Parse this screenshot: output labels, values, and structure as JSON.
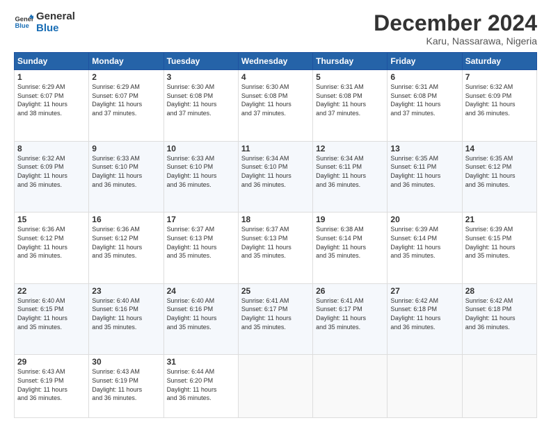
{
  "header": {
    "logo_line1": "General",
    "logo_line2": "Blue",
    "month": "December 2024",
    "location": "Karu, Nassarawa, Nigeria"
  },
  "days_of_week": [
    "Sunday",
    "Monday",
    "Tuesday",
    "Wednesday",
    "Thursday",
    "Friday",
    "Saturday"
  ],
  "weeks": [
    [
      {
        "day": "1",
        "info": "Sunrise: 6:29 AM\nSunset: 6:07 PM\nDaylight: 11 hours\nand 38 minutes."
      },
      {
        "day": "2",
        "info": "Sunrise: 6:29 AM\nSunset: 6:07 PM\nDaylight: 11 hours\nand 37 minutes."
      },
      {
        "day": "3",
        "info": "Sunrise: 6:30 AM\nSunset: 6:08 PM\nDaylight: 11 hours\nand 37 minutes."
      },
      {
        "day": "4",
        "info": "Sunrise: 6:30 AM\nSunset: 6:08 PM\nDaylight: 11 hours\nand 37 minutes."
      },
      {
        "day": "5",
        "info": "Sunrise: 6:31 AM\nSunset: 6:08 PM\nDaylight: 11 hours\nand 37 minutes."
      },
      {
        "day": "6",
        "info": "Sunrise: 6:31 AM\nSunset: 6:08 PM\nDaylight: 11 hours\nand 37 minutes."
      },
      {
        "day": "7",
        "info": "Sunrise: 6:32 AM\nSunset: 6:09 PM\nDaylight: 11 hours\nand 36 minutes."
      }
    ],
    [
      {
        "day": "8",
        "info": "Sunrise: 6:32 AM\nSunset: 6:09 PM\nDaylight: 11 hours\nand 36 minutes."
      },
      {
        "day": "9",
        "info": "Sunrise: 6:33 AM\nSunset: 6:10 PM\nDaylight: 11 hours\nand 36 minutes."
      },
      {
        "day": "10",
        "info": "Sunrise: 6:33 AM\nSunset: 6:10 PM\nDaylight: 11 hours\nand 36 minutes."
      },
      {
        "day": "11",
        "info": "Sunrise: 6:34 AM\nSunset: 6:10 PM\nDaylight: 11 hours\nand 36 minutes."
      },
      {
        "day": "12",
        "info": "Sunrise: 6:34 AM\nSunset: 6:11 PM\nDaylight: 11 hours\nand 36 minutes."
      },
      {
        "day": "13",
        "info": "Sunrise: 6:35 AM\nSunset: 6:11 PM\nDaylight: 11 hours\nand 36 minutes."
      },
      {
        "day": "14",
        "info": "Sunrise: 6:35 AM\nSunset: 6:12 PM\nDaylight: 11 hours\nand 36 minutes."
      }
    ],
    [
      {
        "day": "15",
        "info": "Sunrise: 6:36 AM\nSunset: 6:12 PM\nDaylight: 11 hours\nand 36 minutes."
      },
      {
        "day": "16",
        "info": "Sunrise: 6:36 AM\nSunset: 6:12 PM\nDaylight: 11 hours\nand 35 minutes."
      },
      {
        "day": "17",
        "info": "Sunrise: 6:37 AM\nSunset: 6:13 PM\nDaylight: 11 hours\nand 35 minutes."
      },
      {
        "day": "18",
        "info": "Sunrise: 6:37 AM\nSunset: 6:13 PM\nDaylight: 11 hours\nand 35 minutes."
      },
      {
        "day": "19",
        "info": "Sunrise: 6:38 AM\nSunset: 6:14 PM\nDaylight: 11 hours\nand 35 minutes."
      },
      {
        "day": "20",
        "info": "Sunrise: 6:39 AM\nSunset: 6:14 PM\nDaylight: 11 hours\nand 35 minutes."
      },
      {
        "day": "21",
        "info": "Sunrise: 6:39 AM\nSunset: 6:15 PM\nDaylight: 11 hours\nand 35 minutes."
      }
    ],
    [
      {
        "day": "22",
        "info": "Sunrise: 6:40 AM\nSunset: 6:15 PM\nDaylight: 11 hours\nand 35 minutes."
      },
      {
        "day": "23",
        "info": "Sunrise: 6:40 AM\nSunset: 6:16 PM\nDaylight: 11 hours\nand 35 minutes."
      },
      {
        "day": "24",
        "info": "Sunrise: 6:40 AM\nSunset: 6:16 PM\nDaylight: 11 hours\nand 35 minutes."
      },
      {
        "day": "25",
        "info": "Sunrise: 6:41 AM\nSunset: 6:17 PM\nDaylight: 11 hours\nand 35 minutes."
      },
      {
        "day": "26",
        "info": "Sunrise: 6:41 AM\nSunset: 6:17 PM\nDaylight: 11 hours\nand 35 minutes."
      },
      {
        "day": "27",
        "info": "Sunrise: 6:42 AM\nSunset: 6:18 PM\nDaylight: 11 hours\nand 36 minutes."
      },
      {
        "day": "28",
        "info": "Sunrise: 6:42 AM\nSunset: 6:18 PM\nDaylight: 11 hours\nand 36 minutes."
      }
    ],
    [
      {
        "day": "29",
        "info": "Sunrise: 6:43 AM\nSunset: 6:19 PM\nDaylight: 11 hours\nand 36 minutes."
      },
      {
        "day": "30",
        "info": "Sunrise: 6:43 AM\nSunset: 6:19 PM\nDaylight: 11 hours\nand 36 minutes."
      },
      {
        "day": "31",
        "info": "Sunrise: 6:44 AM\nSunset: 6:20 PM\nDaylight: 11 hours\nand 36 minutes."
      },
      {
        "day": "",
        "info": ""
      },
      {
        "day": "",
        "info": ""
      },
      {
        "day": "",
        "info": ""
      },
      {
        "day": "",
        "info": ""
      }
    ]
  ]
}
